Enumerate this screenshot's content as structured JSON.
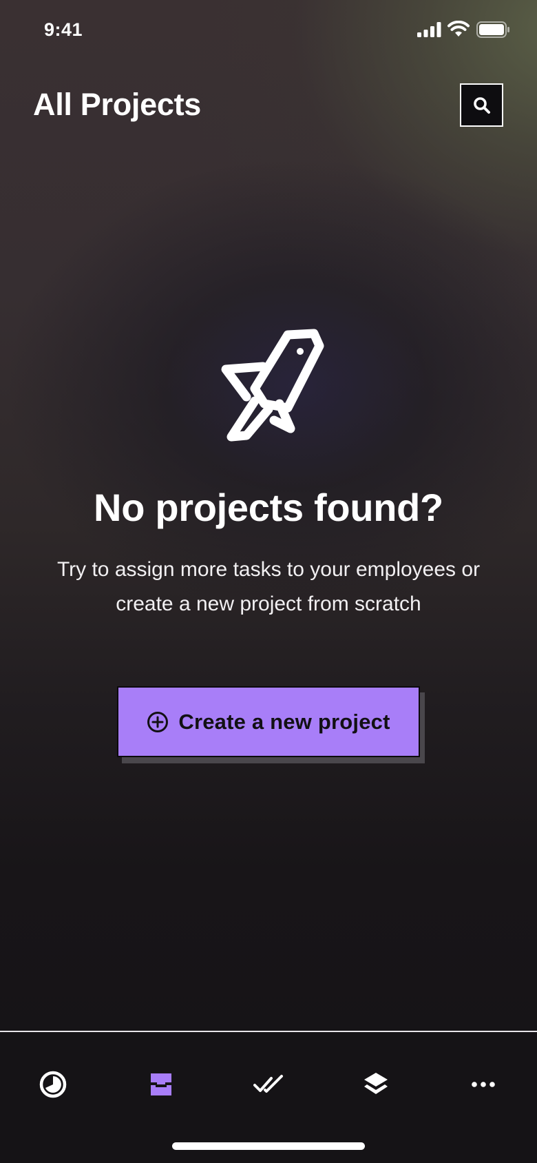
{
  "status_bar": {
    "time": "9:41"
  },
  "header": {
    "title": "All Projects",
    "search_icon": "search-icon"
  },
  "empty_state": {
    "icon": "rocket-icon",
    "title": "No projects found?",
    "description": "Try to assign more tasks to your employees or create a new project from scratch"
  },
  "cta": {
    "label": "Create a new project",
    "icon": "plus-circle-icon",
    "background_color": "#a87ef8"
  },
  "tab_bar": {
    "items": [
      {
        "id": "dashboard",
        "icon": "pie-clock-icon",
        "active": false
      },
      {
        "id": "projects",
        "icon": "inbox-tray-icon",
        "active": true
      },
      {
        "id": "tasks",
        "icon": "double-check-icon",
        "active": false
      },
      {
        "id": "layers",
        "icon": "layers-icon",
        "active": false
      },
      {
        "id": "more",
        "icon": "more-dots-icon",
        "active": false
      }
    ],
    "active_color": "#a87ef8",
    "inactive_color": "#ffffff"
  }
}
